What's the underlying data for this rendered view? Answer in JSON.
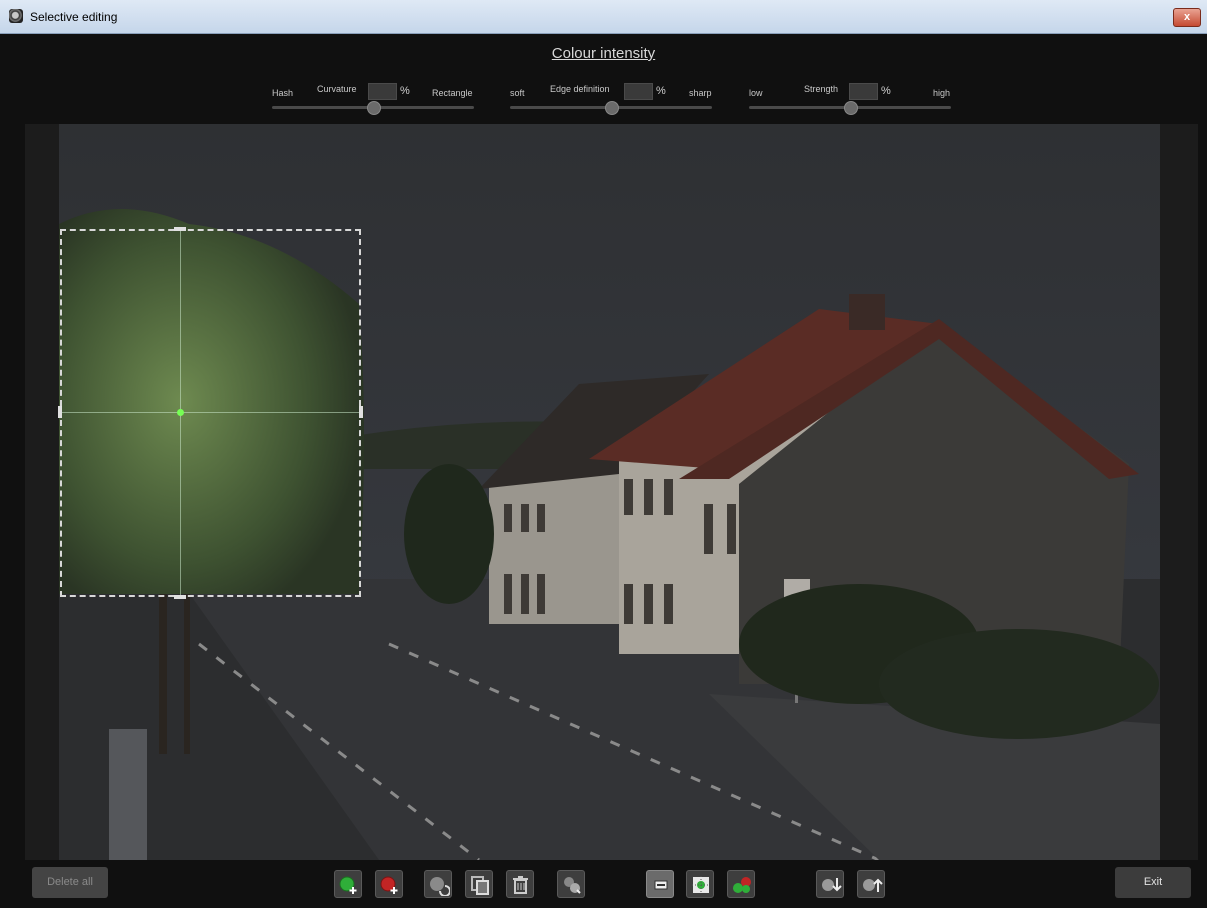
{
  "window": {
    "title": "Selective editing",
    "close_label": "x"
  },
  "panel": {
    "title": "Colour intensity"
  },
  "sliders": [
    {
      "left_label": "Hash",
      "name": "Curvature",
      "value": "",
      "unit": "%",
      "right_label": "Rectangle",
      "position": 0.5
    },
    {
      "left_label": "soft",
      "name": "Edge definition",
      "value": "",
      "unit": "%",
      "right_label": "sharp",
      "position": 0.5
    },
    {
      "left_label": "low",
      "name": "Strength",
      "value": "",
      "unit": "%",
      "right_label": "high",
      "position": 0.5
    }
  ],
  "toolbar": {
    "delete_all_label": "Delete all",
    "exit_label": "Exit",
    "icons": [
      "add-green-point-icon",
      "add-red-point-icon",
      "rotate-icon",
      "copy-icon",
      "trash-icon",
      "reset-icon",
      "rectangle-mask-icon",
      "point-mask-icon",
      "multi-point-icon",
      "import-icon",
      "export-icon"
    ]
  },
  "colors": {
    "selection_center": "#77ff55",
    "background": "#101010"
  }
}
